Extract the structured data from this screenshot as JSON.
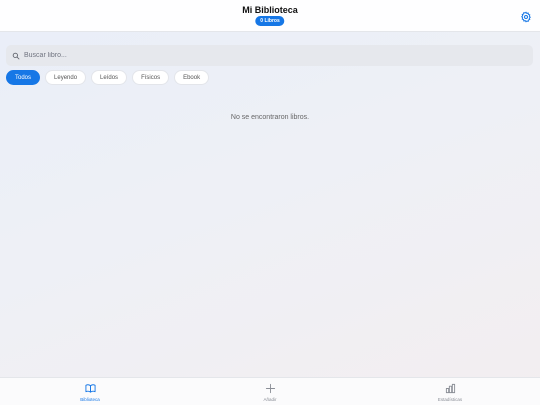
{
  "header": {
    "title": "Mi Biblioteca",
    "badge": "0 Libros",
    "settings_icon": "gear-icon"
  },
  "search": {
    "placeholder": "Buscar libro...",
    "value": "",
    "icon": "search-icon"
  },
  "filters": [
    {
      "label": "Todos",
      "active": true
    },
    {
      "label": "Leyendo",
      "active": false
    },
    {
      "label": "Leídos",
      "active": false
    },
    {
      "label": "Físicos",
      "active": false
    },
    {
      "label": "Ebook",
      "active": false
    }
  ],
  "empty_message": "No se encontraron libros.",
  "tabbar": {
    "items": [
      {
        "label": "Biblioteca",
        "icon": "book-icon",
        "active": true
      },
      {
        "label": "Añadir",
        "icon": "plus-icon",
        "active": false
      },
      {
        "label": "Estadísticas",
        "icon": "bar-chart-icon",
        "active": false
      }
    ]
  },
  "colors": {
    "accent": "#1677e6",
    "inactive": "#8a8e96"
  }
}
